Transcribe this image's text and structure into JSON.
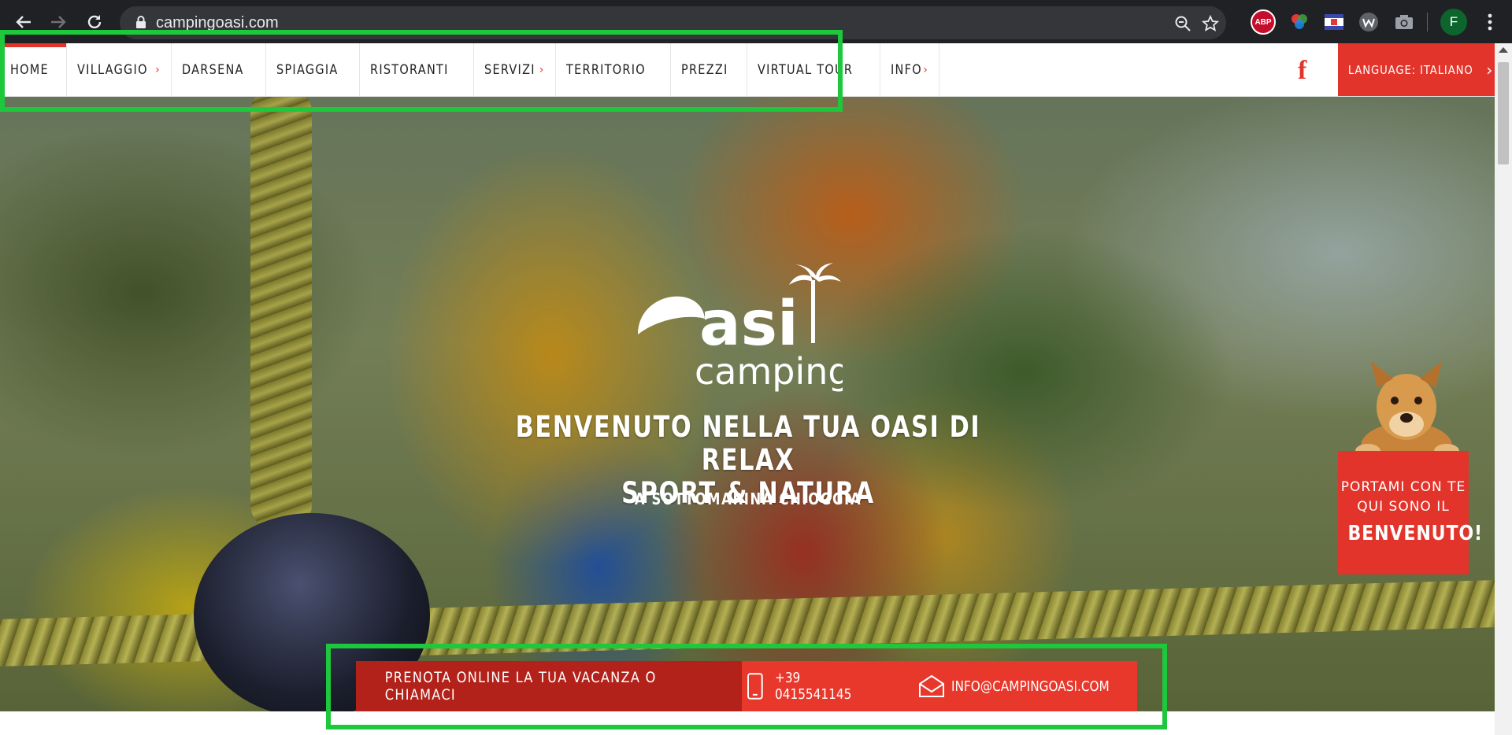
{
  "browser": {
    "url": "campingoasi.com",
    "profile_initial": "F",
    "extensions": [
      "abp-icon",
      "color-wheel-icon",
      "flag-extension-icon",
      "w-extension-icon",
      "camera-icon"
    ]
  },
  "nav": {
    "items": [
      {
        "label": "HOME",
        "active": true,
        "has_submenu": false
      },
      {
        "label": "VILLAGGIO",
        "active": false,
        "has_submenu": true
      },
      {
        "label": "DARSENA",
        "active": false,
        "has_submenu": false
      },
      {
        "label": "SPIAGGIA",
        "active": false,
        "has_submenu": false
      },
      {
        "label": "RISTORANTI",
        "active": false,
        "has_submenu": false
      },
      {
        "label": "SERVIZI",
        "active": false,
        "has_submenu": true
      },
      {
        "label": "TERRITORIO",
        "active": false,
        "has_submenu": false
      },
      {
        "label": "PREZZI",
        "active": false,
        "has_submenu": false
      },
      {
        "label": "VIRTUAL TOUR",
        "active": false,
        "has_submenu": false
      },
      {
        "label": "INFO",
        "active": false,
        "has_submenu": true
      }
    ],
    "caret": "›",
    "facebook": "f",
    "language_label": "LANGUAGE: ITALIANO",
    "language_chevron": "›"
  },
  "hero": {
    "logo_main": "asi",
    "logo_sub": "camping",
    "headline_line1": "BENVENUTO NELLA TUA OASI DI RELAX",
    "headline_line2": "SPORT & NATURA",
    "subline": "A SOTTOMARINA CHIOGGIA"
  },
  "dog_promo": {
    "line1": "PORTAMI CON TE",
    "line2": "QUI SONO IL",
    "line3": "BENVENUTO!"
  },
  "booking": {
    "cta": "PRENOTA ONLINE LA TUA VACANZA O CHIAMACI",
    "phone": "+39 0415541145",
    "email": "INFO@CAMPINGOASI.COM"
  },
  "colors": {
    "accent": "#e2342b",
    "accent_dark": "#b3221a",
    "highlight": "#1ec83c",
    "chrome": "#202124"
  }
}
